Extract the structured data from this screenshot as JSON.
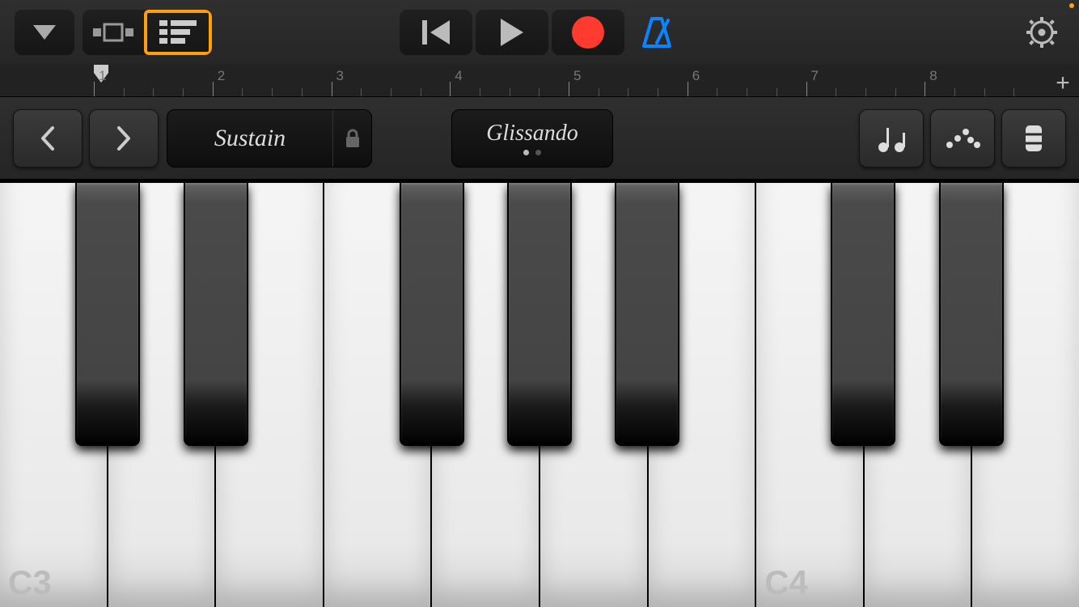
{
  "toolbar": {
    "view_selected": 1,
    "metronome_on": true
  },
  "ruler": {
    "bars": [
      "1",
      "2",
      "3",
      "4",
      "5",
      "6",
      "7",
      "8"
    ],
    "playhead_bar": 1,
    "add_label": "+"
  },
  "controls": {
    "sustain_label": "Sustain",
    "glissando_label": "Glissando",
    "glissando_page": 0,
    "glissando_pages": 2
  },
  "keyboard": {
    "white_count": 10,
    "labels": {
      "0": "C3",
      "7": "C4"
    },
    "black_at_white_gap": [
      0,
      1,
      3,
      4,
      5,
      7,
      8
    ],
    "black_comment": "index = gap-after-white-key index where a black key sits"
  },
  "colors": {
    "accent": "#ff9f0a",
    "record": "#ff3b30",
    "metronome": "#0a84ff"
  }
}
